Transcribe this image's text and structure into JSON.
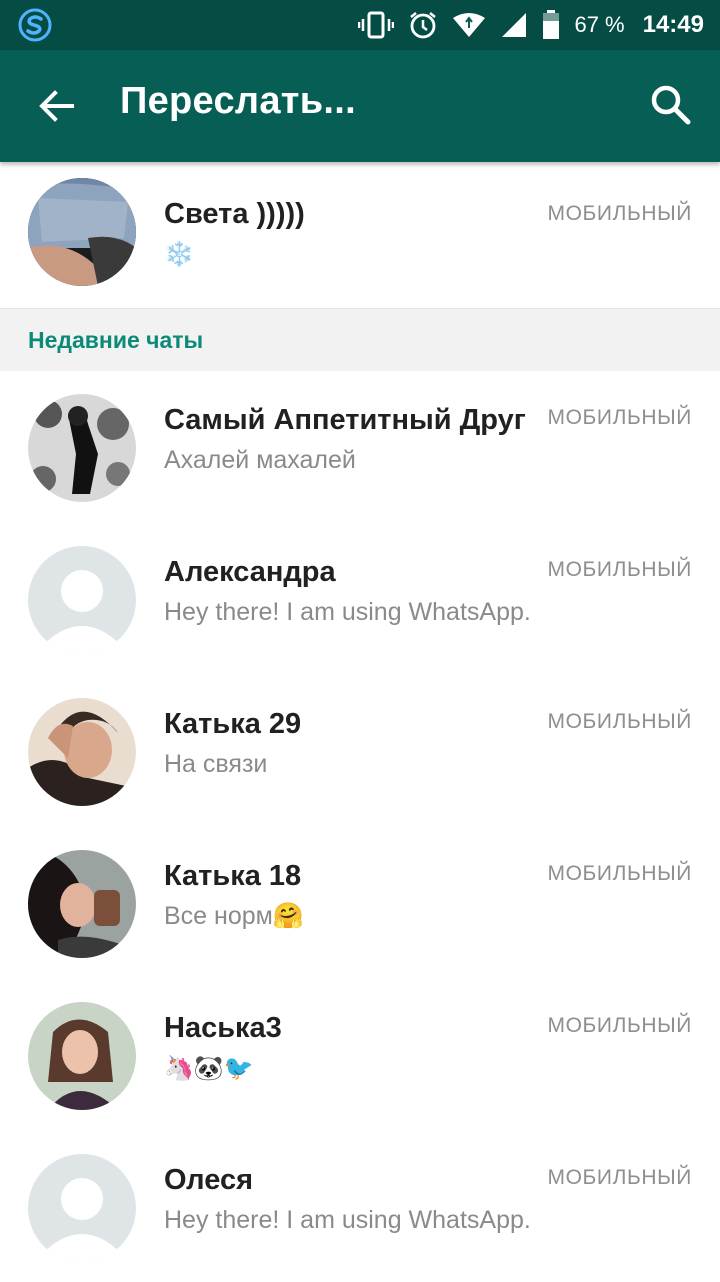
{
  "status_bar": {
    "battery": "67 %",
    "time": "14:49"
  },
  "toolbar": {
    "title": "Переслать...",
    "back_icon": "arrow-left-icon",
    "search_icon": "search-icon"
  },
  "top_contact": {
    "name": "Света )))))",
    "status": "❄️",
    "type": "МОБИЛЬНЫЙ"
  },
  "section": {
    "title": "Недавние чаты"
  },
  "chats": [
    {
      "name": "Самый Аппетитный Друг",
      "status": "Ахалей махалей",
      "type": "МОБИЛЬНЫЙ"
    },
    {
      "name": "Александра",
      "status": "Hey there! I am using WhatsApp.",
      "type": "МОБИЛЬНЫЙ"
    },
    {
      "name": "Катька 29",
      "status": "На связи",
      "type": "МОБИЛЬНЫЙ"
    },
    {
      "name": "Катька 18",
      "status": "Все норм🤗",
      "type": "МОБИЛЬНЫЙ"
    },
    {
      "name": "Наська3",
      "status": "🦄🐼🐦",
      "type": "МОБИЛЬНЫЙ"
    },
    {
      "name": "Олеся",
      "status": "Hey there! I am using WhatsApp.",
      "type": "МОБИЛЬНЫЙ"
    }
  ],
  "colors": {
    "status_bar": "#054d44",
    "toolbar": "#075e54",
    "section_accent": "#0b8a78"
  }
}
